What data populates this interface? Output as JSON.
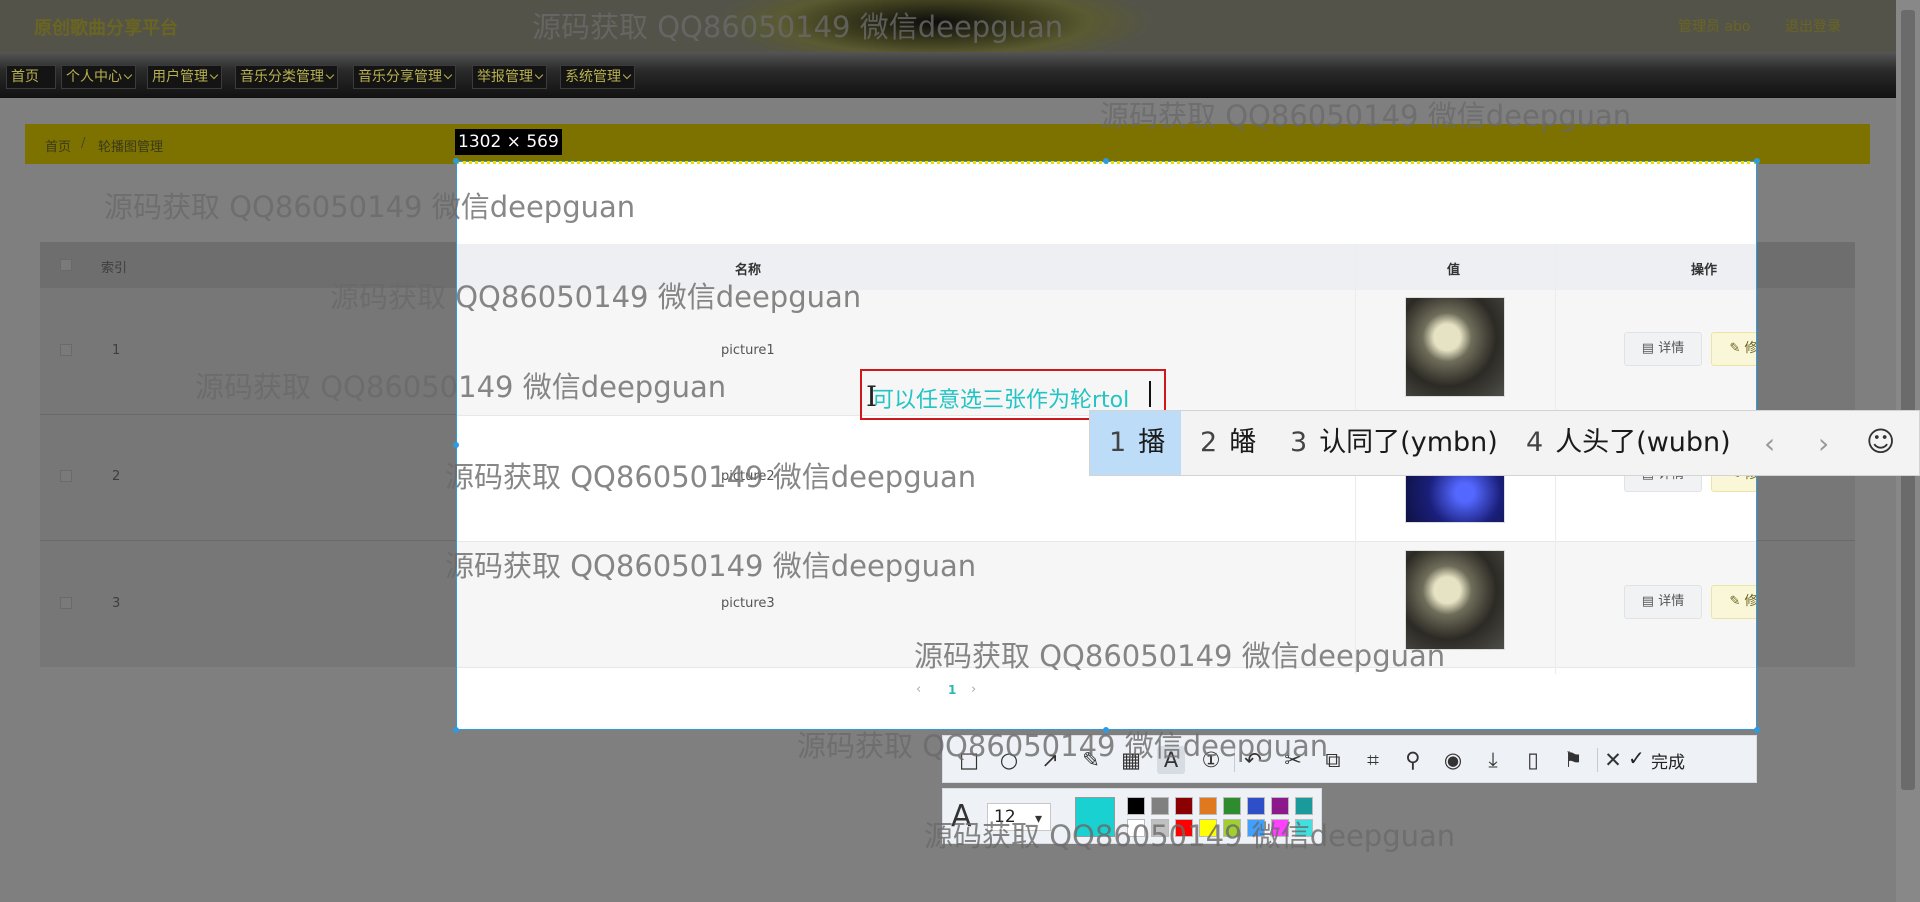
{
  "app": {
    "title": "原创歌曲分享平台",
    "user": "管理员 abo",
    "logout": "退出登录"
  },
  "nav": {
    "items": [
      "首页",
      "个人中心",
      "用户管理",
      "音乐分类管理",
      "音乐分享管理",
      "举报管理",
      "系统管理"
    ]
  },
  "breadcrumb": {
    "home": "首页",
    "separator": "/",
    "current": "轮播图管理"
  },
  "selection": {
    "size_label": "1302 × 569"
  },
  "table": {
    "headers": {
      "index": "索引",
      "name": "名称",
      "value": "值",
      "action": "操作"
    },
    "rows": [
      {
        "index": "1",
        "name": "picture1",
        "detail": "详情",
        "edit": "修改"
      },
      {
        "index": "2",
        "name": "picture2",
        "detail": "详情",
        "edit": "修改"
      },
      {
        "index": "3",
        "name": "picture3",
        "detail": "详情",
        "edit": "修改"
      }
    ],
    "pager": {
      "prev": "‹",
      "current": "1",
      "next": "›"
    }
  },
  "annotation": {
    "text": "可以任意选三张作为轮rtol"
  },
  "ime": {
    "candidates": [
      {
        "num": "1",
        "text": "播"
      },
      {
        "num": "2",
        "text": "皤"
      },
      {
        "num": "3",
        "text": "认同了(ymbn)"
      },
      {
        "num": "4",
        "text": "人头了(wubn)"
      }
    ],
    "prev": "‹",
    "next": "›",
    "emoji": "☺"
  },
  "toolbar": {
    "done_label": "完成",
    "font_size": "12",
    "current_color": "#1ad1d1",
    "swatches_top": [
      "#000000",
      "#808080",
      "#8b0000",
      "#e07820",
      "#2e8b2e",
      "#2f4fc9",
      "#8b1a8b",
      "#1a9a9a"
    ],
    "swatches_bottom": [
      "#ffffff",
      "#c0c0c0",
      "#ff0000",
      "#ffff00",
      "#a0d030",
      "#40a0ff",
      "#ff40ff",
      "#40e0e0"
    ]
  },
  "watermark": {
    "text": "源码获取 QQ86050149 微信deepguan"
  }
}
